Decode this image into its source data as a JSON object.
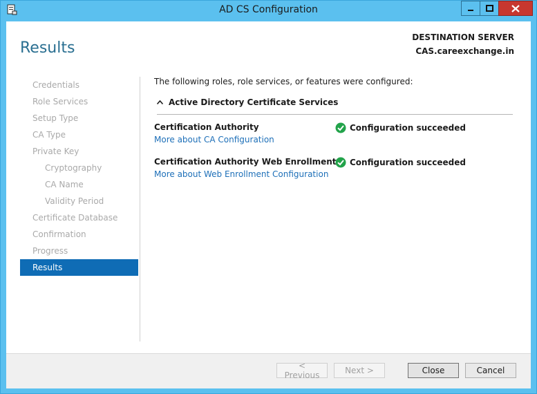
{
  "window": {
    "title": "AD CS Configuration"
  },
  "header": {
    "page_title": "Results",
    "destination_label": "DESTINATION SERVER",
    "destination_value": "CAS.careexchange.in"
  },
  "nav": {
    "items": [
      {
        "label": "Credentials"
      },
      {
        "label": "Role Services"
      },
      {
        "label": "Setup Type"
      },
      {
        "label": "CA Type"
      },
      {
        "label": "Private Key"
      },
      {
        "label": "Cryptography"
      },
      {
        "label": "CA Name"
      },
      {
        "label": "Validity Period"
      },
      {
        "label": "Certificate Database"
      },
      {
        "label": "Confirmation"
      },
      {
        "label": "Progress"
      },
      {
        "label": "Results"
      }
    ]
  },
  "content": {
    "intro": "The following roles, role services, or features were configured:",
    "section_title": "Active Directory Certificate Services",
    "rows": [
      {
        "name": "Certification Authority",
        "link": "More about CA Configuration",
        "status": "Configuration succeeded"
      },
      {
        "name": "Certification Authority Web Enrollment",
        "link": "More about Web Enrollment Configuration",
        "status": "Configuration succeeded"
      }
    ]
  },
  "footer": {
    "previous": "< Previous",
    "next": "Next >",
    "close": "Close",
    "cancel": "Cancel"
  },
  "colors": {
    "title_bar": "#5bc0ef",
    "accent": "#0f6cb5",
    "link": "#1d6fb8",
    "success": "#22a34a"
  }
}
